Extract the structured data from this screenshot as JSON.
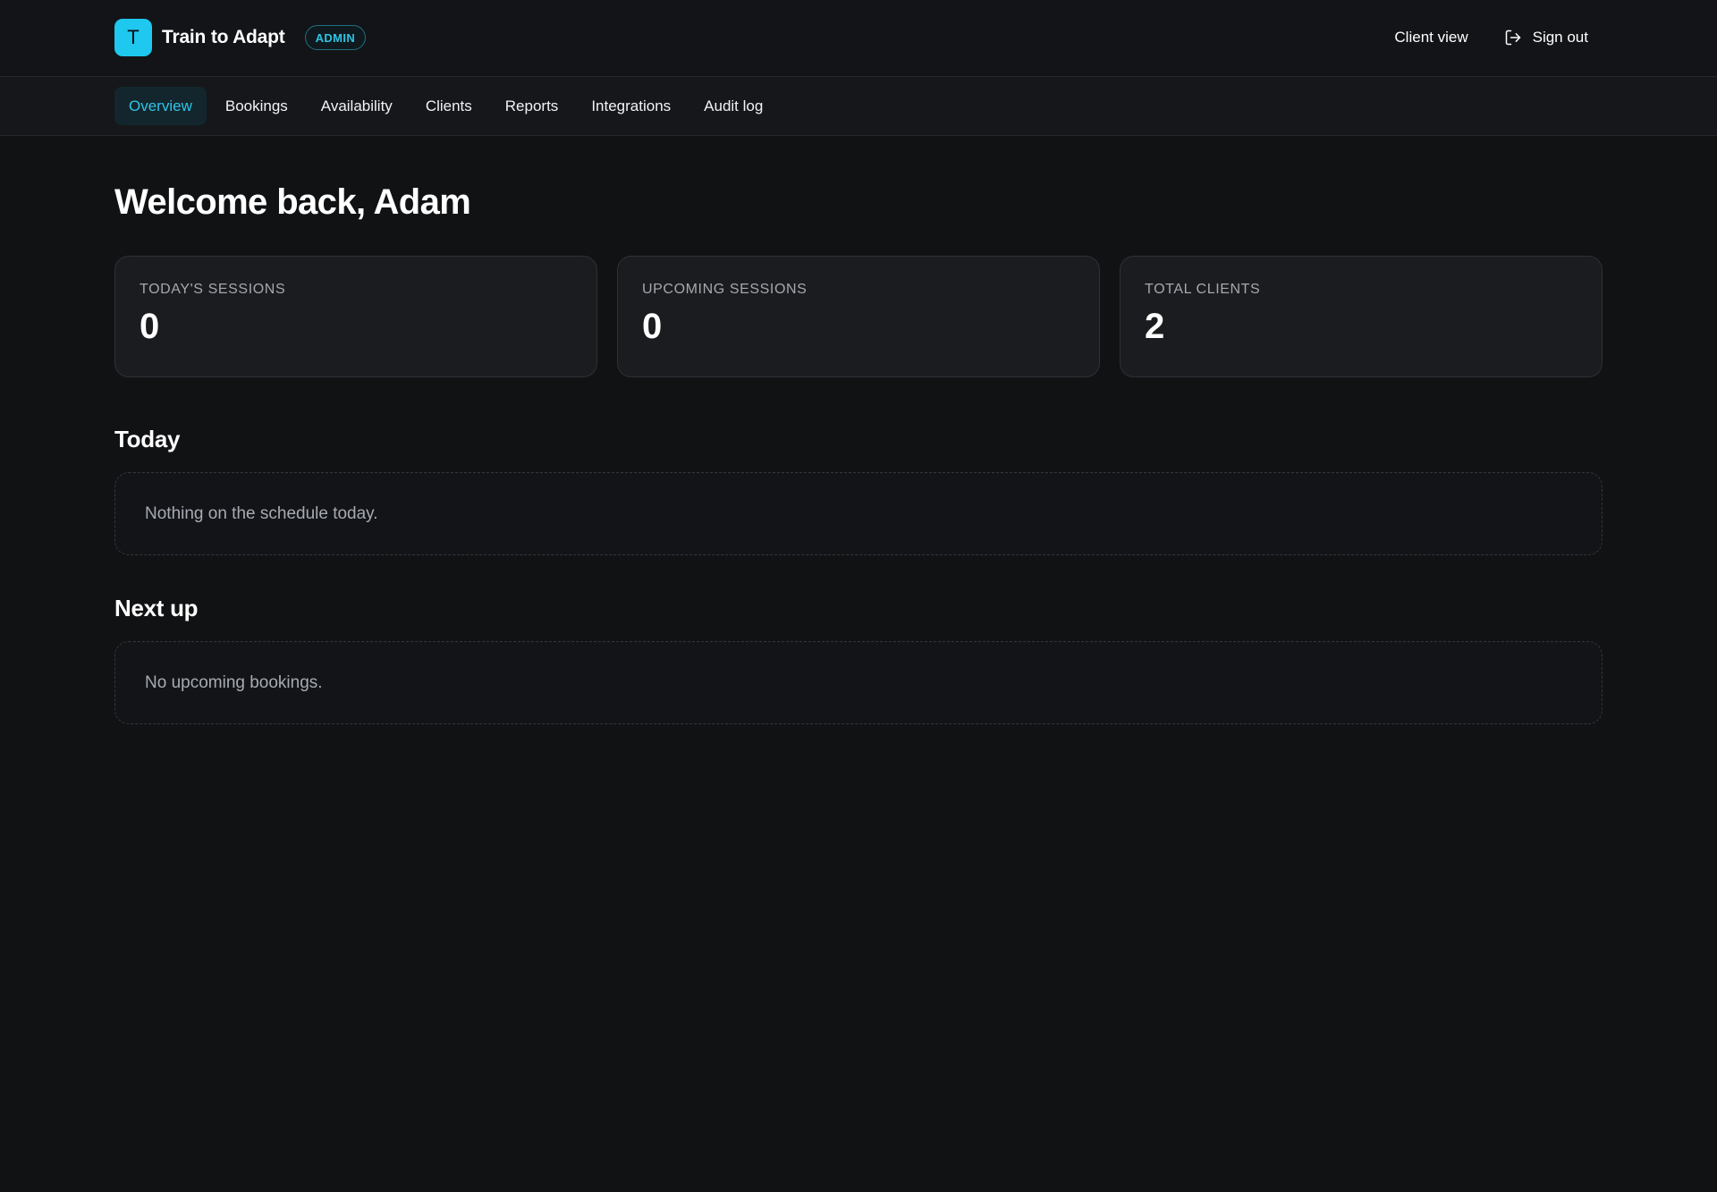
{
  "header": {
    "logo_letter": "T",
    "app_name": "Train to Adapt",
    "role_badge": "ADMIN",
    "client_view_label": "Client view",
    "sign_out_label": "Sign out"
  },
  "nav": {
    "tabs": [
      {
        "label": "Overview",
        "active": true
      },
      {
        "label": "Bookings",
        "active": false
      },
      {
        "label": "Availability",
        "active": false
      },
      {
        "label": "Clients",
        "active": false
      },
      {
        "label": "Reports",
        "active": false
      },
      {
        "label": "Integrations",
        "active": false
      },
      {
        "label": "Audit log",
        "active": false
      }
    ]
  },
  "main": {
    "title": "Welcome back, Adam",
    "stats": [
      {
        "label": "TODAY'S SESSIONS",
        "value": "0"
      },
      {
        "label": "UPCOMING SESSIONS",
        "value": "0"
      },
      {
        "label": "TOTAL CLIENTS",
        "value": "2"
      }
    ],
    "today": {
      "title": "Today",
      "empty_message": "Nothing on the schedule today."
    },
    "next_up": {
      "title": "Next up",
      "empty_message": "No upcoming bookings."
    }
  },
  "icons": {
    "sign_out": "sign-out-icon"
  },
  "colors": {
    "accent": "#1ec8ef",
    "background": "#111214",
    "card": "#1b1c1f"
  }
}
